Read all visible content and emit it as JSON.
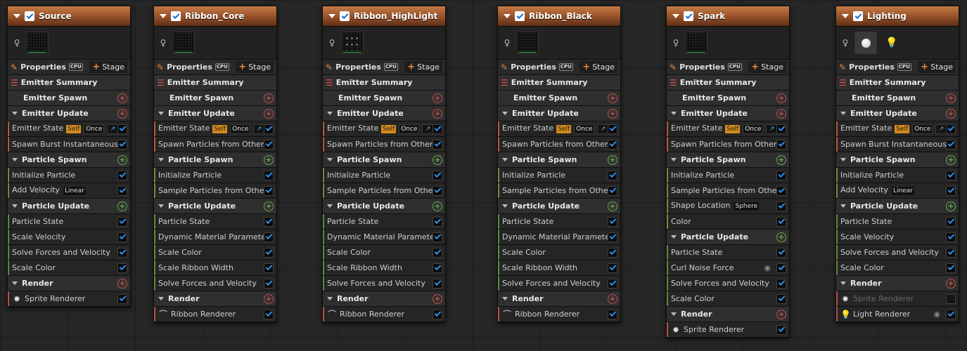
{
  "ui": {
    "properties": "Properties",
    "cpu": "CPU",
    "stage": "Stage",
    "emitter_summary": "Emitter Summary"
  },
  "emitters": [
    {
      "name": "Source",
      "thumb": "preview",
      "sections": [
        {
          "kind": "section",
          "label": "Emitter Spawn",
          "collapsible": false,
          "add": "red"
        },
        {
          "kind": "section",
          "label": "Emitter Update",
          "collapsible": true,
          "add": "red"
        },
        {
          "kind": "module",
          "group": "em",
          "label": "Emitter State",
          "tags": [
            "Self",
            "Once",
            "curve"
          ],
          "checked": true
        },
        {
          "kind": "module",
          "group": "em",
          "label": "Spawn Burst Instantaneous",
          "checked": true
        },
        {
          "kind": "section",
          "label": "Particle Spawn",
          "collapsible": true,
          "add": "green"
        },
        {
          "kind": "module",
          "group": "sp",
          "label": "Initialize Particle",
          "checked": true
        },
        {
          "kind": "module",
          "group": "sp",
          "label": "Add Velocity",
          "badge": "Linear",
          "checked": true
        },
        {
          "kind": "section",
          "label": "Particle Update",
          "collapsible": true,
          "add": "green"
        },
        {
          "kind": "module",
          "group": "up",
          "label": "Particle State",
          "checked": true
        },
        {
          "kind": "module",
          "group": "up",
          "label": "Scale Velocity",
          "checked": true
        },
        {
          "kind": "module",
          "group": "up",
          "label": "Solve Forces and Velocity",
          "checked": true
        },
        {
          "kind": "module",
          "group": "up",
          "label": "Scale Color",
          "checked": true
        },
        {
          "kind": "section",
          "label": "Render",
          "collapsible": true,
          "add": "red"
        },
        {
          "kind": "renderer",
          "group": "rn",
          "label": "Sprite Renderer",
          "icon": "sprite-icon",
          "checked": true
        }
      ]
    },
    {
      "name": "Ribbon_Core",
      "thumb": "preview",
      "sections": [
        {
          "kind": "section",
          "label": "Emitter Spawn",
          "collapsible": false,
          "add": "red"
        },
        {
          "kind": "section",
          "label": "Emitter Update",
          "collapsible": true,
          "add": "red"
        },
        {
          "kind": "module",
          "group": "em",
          "label": "Emitter State",
          "tags": [
            "Self",
            "Once",
            "curve"
          ],
          "checked": true
        },
        {
          "kind": "module",
          "group": "em",
          "label": "Spawn Particles from Other Emitter",
          "checked": true
        },
        {
          "kind": "section",
          "label": "Particle Spawn",
          "collapsible": true,
          "add": "green"
        },
        {
          "kind": "module",
          "group": "sp",
          "label": "Initialize Particle",
          "checked": true
        },
        {
          "kind": "module",
          "group": "sp",
          "label": "Sample Particles from Other Emitter",
          "checked": true
        },
        {
          "kind": "section",
          "label": "Particle Update",
          "collapsible": true,
          "add": "green"
        },
        {
          "kind": "module",
          "group": "up",
          "label": "Particle State",
          "checked": true
        },
        {
          "kind": "module",
          "group": "up",
          "label": "Dynamic Material Parameters",
          "checked": true
        },
        {
          "kind": "module",
          "group": "up",
          "label": "Scale Color",
          "checked": true
        },
        {
          "kind": "module",
          "group": "up",
          "label": "Scale Ribbon Width",
          "checked": true
        },
        {
          "kind": "module",
          "group": "up",
          "label": "Solve Forces and Velocity",
          "checked": true
        },
        {
          "kind": "section",
          "label": "Render",
          "collapsible": true,
          "add": "red"
        },
        {
          "kind": "renderer",
          "group": "rn",
          "label": "Ribbon Renderer",
          "icon": "ribbon-icon",
          "checked": true
        }
      ]
    },
    {
      "name": "Ribbon_HighLight",
      "thumb": "sparks",
      "sections": [
        {
          "kind": "section",
          "label": "Emitter Spawn",
          "collapsible": false,
          "add": "red"
        },
        {
          "kind": "section",
          "label": "Emitter Update",
          "collapsible": true,
          "add": "red"
        },
        {
          "kind": "module",
          "group": "em",
          "label": "Emitter State",
          "tags": [
            "Self",
            "Once",
            "curve"
          ],
          "checked": true
        },
        {
          "kind": "module",
          "group": "em",
          "label": "Spawn Particles from Other Emitter",
          "checked": true
        },
        {
          "kind": "section",
          "label": "Particle Spawn",
          "collapsible": true,
          "add": "green"
        },
        {
          "kind": "module",
          "group": "sp",
          "label": "Initialize Particle",
          "checked": true
        },
        {
          "kind": "module",
          "group": "sp",
          "label": "Sample Particles from Other Emitter",
          "checked": true
        },
        {
          "kind": "section",
          "label": "Particle Update",
          "collapsible": true,
          "add": "green"
        },
        {
          "kind": "module",
          "group": "up",
          "label": "Particle State",
          "checked": true
        },
        {
          "kind": "module",
          "group": "up",
          "label": "Dynamic Material Parameters",
          "checked": true
        },
        {
          "kind": "module",
          "group": "up",
          "label": "Scale Color",
          "checked": true
        },
        {
          "kind": "module",
          "group": "up",
          "label": "Scale Ribbon Width",
          "checked": true
        },
        {
          "kind": "module",
          "group": "up",
          "label": "Solve Forces and Velocity",
          "checked": true
        },
        {
          "kind": "section",
          "label": "Render",
          "collapsible": true,
          "add": "red"
        },
        {
          "kind": "renderer",
          "group": "rn",
          "label": "Ribbon Renderer",
          "icon": "ribbon-icon",
          "checked": true
        }
      ]
    },
    {
      "name": "Ribbon_Black",
      "thumb": "preview",
      "sections": [
        {
          "kind": "section",
          "label": "Emitter Spawn",
          "collapsible": false,
          "add": "red"
        },
        {
          "kind": "section",
          "label": "Emitter Update",
          "collapsible": true,
          "add": "red"
        },
        {
          "kind": "module",
          "group": "em",
          "label": "Emitter State",
          "tags": [
            "Self",
            "Once",
            "curve"
          ],
          "checked": true
        },
        {
          "kind": "module",
          "group": "em",
          "label": "Spawn Particles from Other Emitter",
          "checked": true
        },
        {
          "kind": "section",
          "label": "Particle Spawn",
          "collapsible": true,
          "add": "green"
        },
        {
          "kind": "module",
          "group": "sp",
          "label": "Initialize Particle",
          "checked": true
        },
        {
          "kind": "module",
          "group": "sp",
          "label": "Sample Particles from Other Emitter",
          "checked": true
        },
        {
          "kind": "section",
          "label": "Particle Update",
          "collapsible": true,
          "add": "green"
        },
        {
          "kind": "module",
          "group": "up",
          "label": "Particle State",
          "checked": true
        },
        {
          "kind": "module",
          "group": "up",
          "label": "Dynamic Material Parameters",
          "checked": true
        },
        {
          "kind": "module",
          "group": "up",
          "label": "Scale Color",
          "checked": true
        },
        {
          "kind": "module",
          "group": "up",
          "label": "Scale Ribbon Width",
          "checked": true
        },
        {
          "kind": "module",
          "group": "up",
          "label": "Solve Forces and Velocity",
          "checked": true
        },
        {
          "kind": "section",
          "label": "Render",
          "collapsible": true,
          "add": "red"
        },
        {
          "kind": "renderer",
          "group": "rn",
          "label": "Ribbon Renderer",
          "icon": "ribbon-icon",
          "checked": true
        }
      ]
    },
    {
      "name": "Spark",
      "thumb": "preview",
      "sections": [
        {
          "kind": "section",
          "label": "Emitter Spawn",
          "collapsible": false,
          "add": "red"
        },
        {
          "kind": "section",
          "label": "Emitter Update",
          "collapsible": true,
          "add": "red"
        },
        {
          "kind": "module",
          "group": "em",
          "label": "Emitter State",
          "tags": [
            "Self",
            "Once",
            "curve"
          ],
          "checked": true
        },
        {
          "kind": "module",
          "group": "em",
          "label": "Spawn Particles from Other Emitter",
          "checked": true
        },
        {
          "kind": "section",
          "label": "Particle Spawn",
          "collapsible": true,
          "add": "green"
        },
        {
          "kind": "module",
          "group": "sp",
          "label": "Initialize Particle",
          "checked": true
        },
        {
          "kind": "module",
          "group": "sp",
          "label": "Sample Particles from Other Emitter",
          "checked": true
        },
        {
          "kind": "module",
          "group": "sp",
          "label": "Shape Location",
          "badge": "Sphere",
          "checked": true
        },
        {
          "kind": "module",
          "group": "sp",
          "label": "Color",
          "checked": true
        },
        {
          "kind": "section",
          "label": "Particle Update",
          "collapsible": true,
          "add": "green"
        },
        {
          "kind": "module",
          "group": "up",
          "label": "Particle State",
          "checked": true
        },
        {
          "kind": "module",
          "group": "up",
          "label": "Curl Noise Force",
          "eye": true,
          "checked": true
        },
        {
          "kind": "module",
          "group": "up",
          "label": "Solve Forces and Velocity",
          "checked": true
        },
        {
          "kind": "module",
          "group": "up",
          "label": "Scale Color",
          "checked": true
        },
        {
          "kind": "section",
          "label": "Render",
          "collapsible": true,
          "add": "red"
        },
        {
          "kind": "renderer",
          "group": "rn",
          "label": "Sprite Renderer",
          "icon": "sprite-icon",
          "checked": true
        }
      ]
    },
    {
      "name": "Lighting",
      "thumb": "orb",
      "thumb2": "bulb",
      "sections": [
        {
          "kind": "section",
          "label": "Emitter Spawn",
          "collapsible": false,
          "add": "red"
        },
        {
          "kind": "section",
          "label": "Emitter Update",
          "collapsible": true,
          "add": "red"
        },
        {
          "kind": "module",
          "group": "em",
          "label": "Emitter State",
          "tags": [
            "Self",
            "Once",
            "curve"
          ],
          "checked": true
        },
        {
          "kind": "module",
          "group": "em",
          "label": "Spawn Burst Instantaneous",
          "checked": true
        },
        {
          "kind": "section",
          "label": "Particle Spawn",
          "collapsible": true,
          "add": "green"
        },
        {
          "kind": "module",
          "group": "sp",
          "label": "Initialize Particle",
          "checked": true
        },
        {
          "kind": "module",
          "group": "sp",
          "label": "Add Velocity",
          "badge": "Linear",
          "checked": true
        },
        {
          "kind": "section",
          "label": "Particle Update",
          "collapsible": true,
          "add": "green"
        },
        {
          "kind": "module",
          "group": "up",
          "label": "Particle State",
          "checked": true
        },
        {
          "kind": "module",
          "group": "up",
          "label": "Scale Velocity",
          "checked": true
        },
        {
          "kind": "module",
          "group": "up",
          "label": "Solve Forces and Velocity",
          "checked": true
        },
        {
          "kind": "module",
          "group": "up",
          "label": "Scale Color",
          "checked": true
        },
        {
          "kind": "section",
          "label": "Render",
          "collapsible": true,
          "add": "red"
        },
        {
          "kind": "renderer",
          "group": "rn",
          "label": "Sprite Renderer",
          "icon": "sprite-icon",
          "checked": false,
          "disabled": true
        },
        {
          "kind": "renderer",
          "group": "rn",
          "label": "Light Renderer",
          "icon": "bulb-icon",
          "eye": true,
          "checked": true
        }
      ]
    }
  ]
}
